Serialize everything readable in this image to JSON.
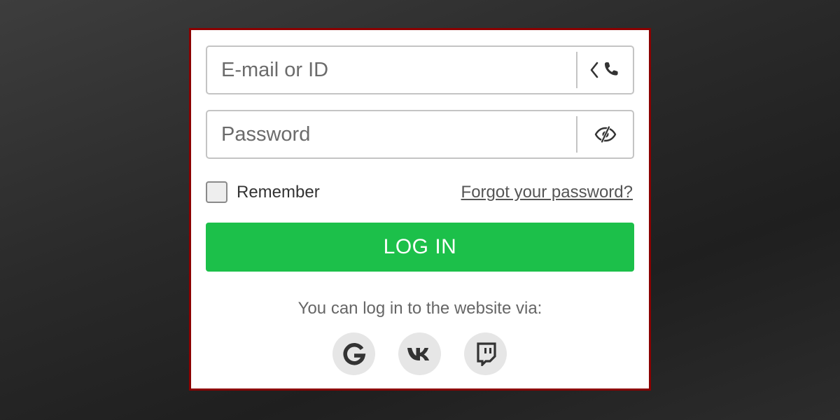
{
  "login": {
    "email_placeholder": "E-mail or ID",
    "password_placeholder": "Password",
    "remember_label": "Remember",
    "forgot_link": "Forgot your password?",
    "login_button": "LOG IN",
    "social_text": "You can log in to the website via:"
  },
  "icons": {
    "email_toggle": [
      "chevron-left-icon",
      "phone-icon"
    ],
    "password_toggle": "eye-slash-icon",
    "social": [
      "google-icon",
      "vk-icon",
      "twitch-icon"
    ]
  },
  "colors": {
    "panel_border": "#8b0000",
    "login_button": "#1cc04a",
    "social_button_bg": "#e6e6e6"
  }
}
